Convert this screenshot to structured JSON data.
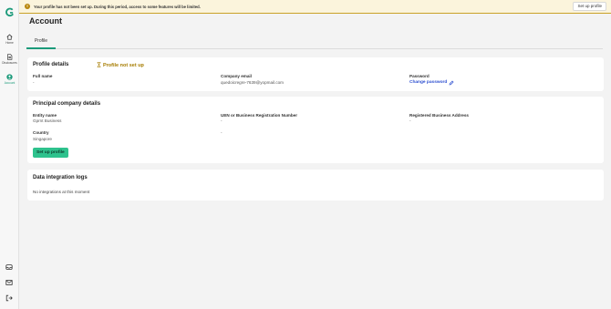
{
  "sidebar": {
    "items": [
      {
        "label": "Home",
        "icon": "home-icon"
      },
      {
        "label": "Disclosures",
        "icon": "document-icon"
      },
      {
        "label": "Account",
        "icon": "account-icon"
      }
    ],
    "footer_icons": [
      "inbox-icon",
      "mail-icon",
      "logout-icon"
    ],
    "logo": "gprnt-logo"
  },
  "banner": {
    "message": "Your profile has not been set up. During this period, access to some features will be limited.",
    "button_label": "Set up profile",
    "icon": "warning-icon"
  },
  "page": {
    "title": "Account",
    "tabs": [
      {
        "label": "Profile",
        "active": true
      }
    ]
  },
  "profile_details": {
    "title": "Profile details",
    "status": "Profile not set up",
    "full_name_label": "Full name",
    "full_name_value": "-",
    "company_email_label": "Company email",
    "company_email_value": "quedoicregre-7639@yopmail.com",
    "password_label": "Password",
    "change_password_label": "Change password"
  },
  "principal_company": {
    "title": "Principal company details",
    "entity_name_label": "Entity name",
    "entity_name_value": "Gprnt Business",
    "uen_label": "UEN or Business Registration Number",
    "uen_value": "-",
    "address_label": "Registered Business Address",
    "address_value": "-",
    "country_label": "Country",
    "country_value": "Singapore",
    "extra_value": "-",
    "setup_button_label": "Set up profile"
  },
  "data_integration": {
    "title": "Data integration logs",
    "empty_message": "No integrations at this moment"
  },
  "colors": {
    "accent": "#1b9a7a",
    "button": "#2ec28d",
    "warning_bg": "#fbf4dc",
    "warning_border": "#c9a227",
    "link": "#2d4fd0"
  }
}
